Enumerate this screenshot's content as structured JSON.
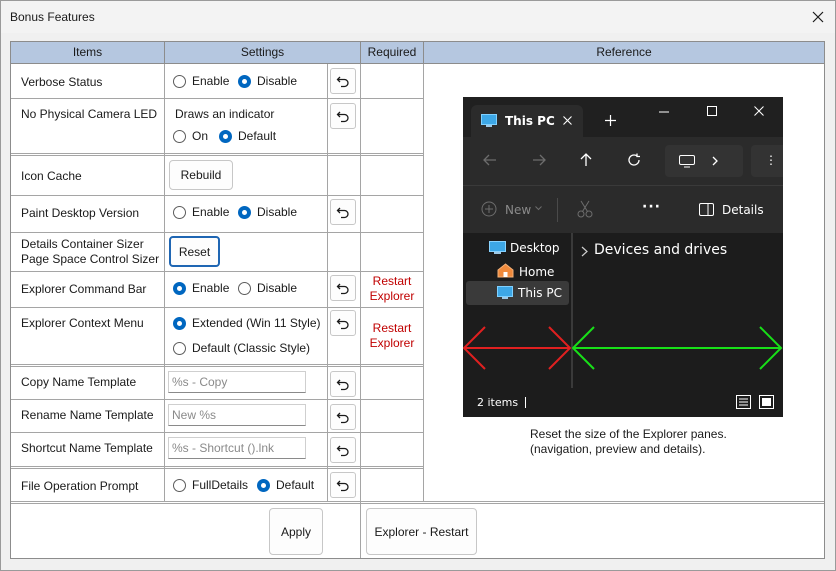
{
  "window": {
    "title": "Bonus Features"
  },
  "headers": {
    "items": "Items",
    "settings": "Settings",
    "required": "Required",
    "reference": "Reference"
  },
  "rows": {
    "verbose_status": {
      "label": "Verbose Status",
      "opt1": "Enable",
      "opt2": "Disable",
      "selected": "Disable"
    },
    "camera_led": {
      "label": "No Physical Camera LED",
      "description": "Draws an indicator",
      "opt1": "On",
      "opt2": "Default",
      "selected": "Default"
    },
    "icon_cache": {
      "label": "Icon Cache",
      "button": "Rebuild"
    },
    "paint_desktop": {
      "label": "Paint Desktop Version",
      "opt1": "Enable",
      "opt2": "Disable",
      "selected": "Disable"
    },
    "sizer": {
      "label1": "Details Container Sizer",
      "label2": "Page Space Control Sizer",
      "button": "Reset"
    },
    "command_bar": {
      "label": "Explorer Command Bar",
      "opt1": "Enable",
      "opt2": "Disable",
      "selected": "Enable",
      "required": "Restart Explorer"
    },
    "context_menu": {
      "label": "Explorer Context Menu",
      "opt1": "Extended (Win 11 Style)",
      "opt2": "Default (Classic Style)",
      "selected": "Extended (Win 11 Style)",
      "required": "Restart Explorer"
    },
    "copy_name": {
      "label": "Copy Name Template",
      "value": "%s - Copy"
    },
    "rename_name": {
      "label": "Rename Name Template",
      "value": "New %s"
    },
    "shortcut_name": {
      "label": "Shortcut Name Template",
      "value": "%s - Shortcut ().lnk"
    },
    "file_prompt": {
      "label": "File Operation Prompt",
      "opt1": "FullDetails",
      "opt2": "Default",
      "selected": "Default"
    }
  },
  "footer": {
    "apply": "Apply",
    "restart": "Explorer - Restart"
  },
  "reference": {
    "caption1": "Reset the size of the Explorer panes.",
    "caption2": "(navigation, preview and details).",
    "explorer": {
      "tab_title": "This PC",
      "new_label": "New",
      "details_label": "Details",
      "nav_items": [
        "Desktop",
        "Home",
        "This PC"
      ],
      "section_title": "Devices and drives",
      "status": "2 items"
    },
    "colors": {
      "nav_arrow": "#e02020",
      "content_arrow": "#18e018"
    }
  }
}
